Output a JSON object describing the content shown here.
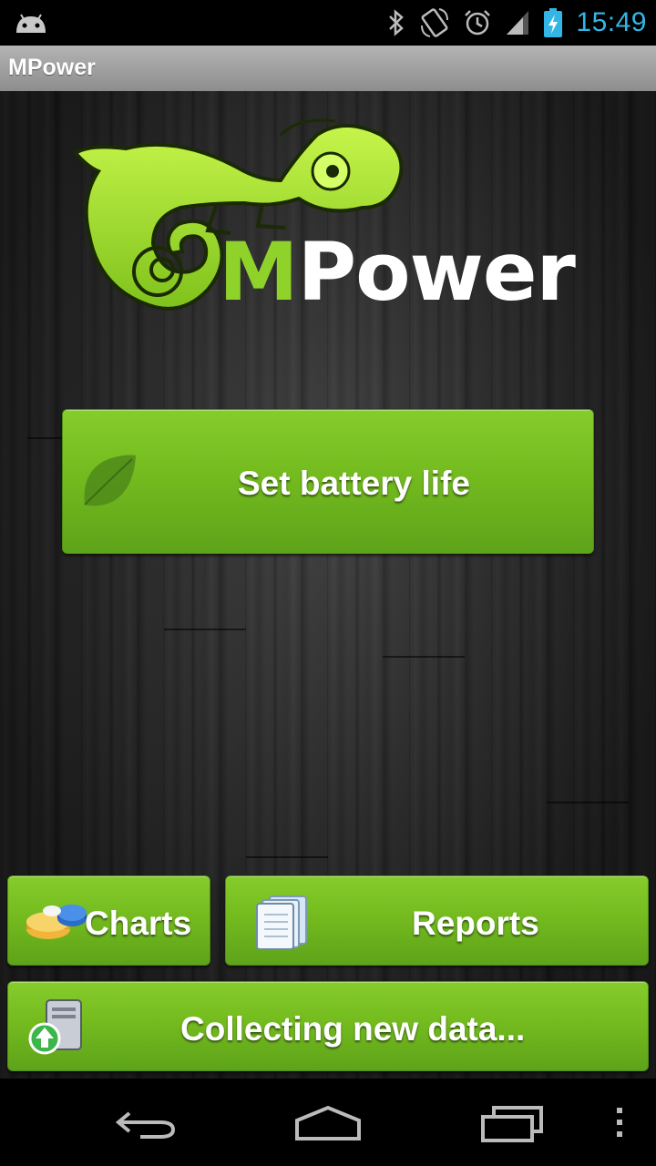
{
  "status_bar": {
    "time": "15:49",
    "icons": [
      "android-debug-icon",
      "bluetooth-icon",
      "rotation-icon",
      "alarm-icon",
      "signal-icon",
      "battery-charging-icon"
    ],
    "clock_color": "#33b5e5"
  },
  "app_bar": {
    "title": "MPower"
  },
  "logo": {
    "text_m": "M",
    "text_rest": "Power",
    "icon": "chameleon-logo"
  },
  "buttons": {
    "battery": {
      "label": "Set battery life",
      "icon": "leaf-icon"
    },
    "charts": {
      "label": "Charts",
      "icon": "pie-chart-icon"
    },
    "reports": {
      "label": "Reports",
      "icon": "notebooks-icon"
    },
    "collect": {
      "label": "Collecting new data...",
      "icon": "upload-data-icon"
    }
  },
  "nav_bar": {
    "icons": [
      "back-icon",
      "home-icon",
      "recent-apps-icon",
      "menu-icon"
    ]
  },
  "colors": {
    "button_green": "#74bb1f",
    "logo_green": "#8fd32a"
  }
}
